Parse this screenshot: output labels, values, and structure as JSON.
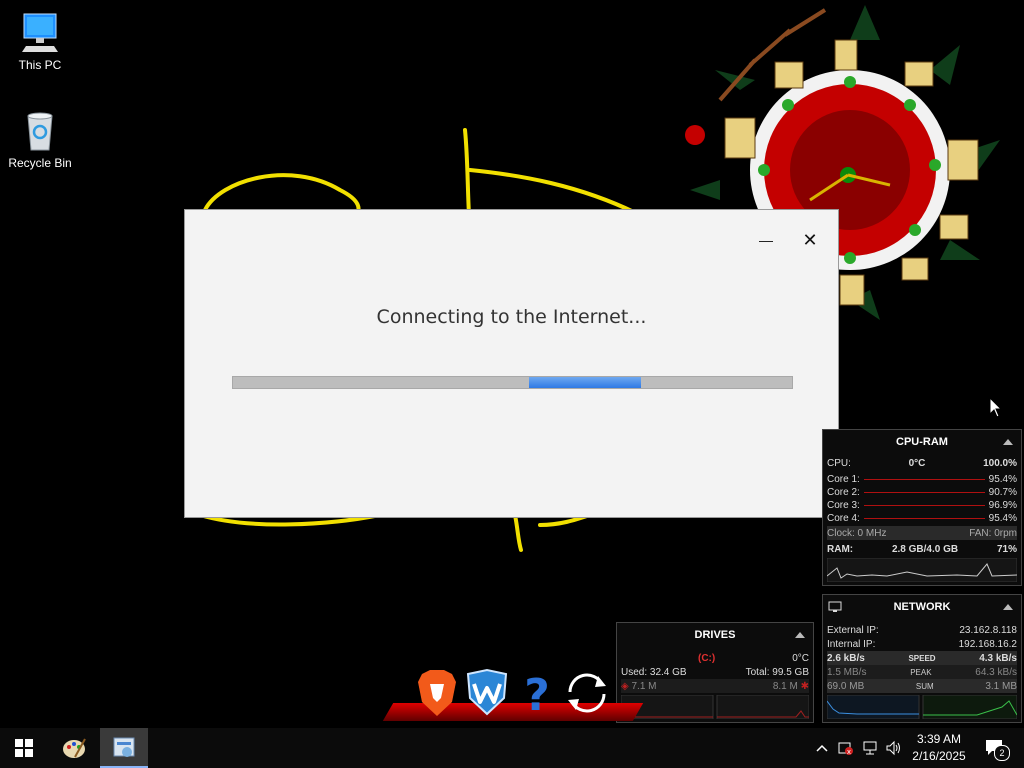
{
  "desktop": {
    "icons": [
      {
        "label": "This PC"
      },
      {
        "label": "Recycle Bin"
      }
    ]
  },
  "dialog": {
    "message": "Connecting to the Internet...",
    "minimize_symbol": "—",
    "close_symbol": "✕",
    "progress_fill": 0.2
  },
  "cpu_ram": {
    "title": "CPU-RAM",
    "cpu_label": "CPU:",
    "cpu_temp": "0°C",
    "cpu_pct": "100.0%",
    "cores": [
      {
        "label": "Core 1:",
        "value": "95.4%"
      },
      {
        "label": "Core 2:",
        "value": "90.7%"
      },
      {
        "label": "Core 3:",
        "value": "96.9%"
      },
      {
        "label": "Core 4:",
        "value": "95.4%"
      }
    ],
    "clock": "Clock: 0 MHz",
    "fan": "FAN: 0rpm",
    "ram_label": "RAM:",
    "ram_value": "2.8 GB/4.0 GB",
    "ram_pct": "71%"
  },
  "network": {
    "title": "NETWORK",
    "external_label": "External IP:",
    "external_ip": "23.162.8.118",
    "internal_label": "Internal IP:",
    "internal_ip": "192.168.16.2",
    "speed_down": "2.6 kB/s",
    "speed_label": "SPEED",
    "speed_up": "4.3 kB/s",
    "peak_down": "1.5 MB/s",
    "peak_label": "PEAK",
    "peak_up": "64.3 kB/s",
    "sum_down": "69.0 MB",
    "sum_label": "SUM",
    "sum_up": "3.1 MB"
  },
  "drives": {
    "title": "DRIVES",
    "drive": "(C:)",
    "temp": "0°C",
    "used": "Used: 32.4 GB",
    "total": "Total: 99.5 GB",
    "read": "7.1 M",
    "write": "8.1 M"
  },
  "taskbar": {
    "time": "3:39 AM",
    "date": "2/16/2025",
    "notification_count": "2"
  },
  "colors": {
    "accent_blue": "#2f7ae5",
    "dock_red": "#d00000",
    "doodle_yellow": "#f2e000"
  }
}
